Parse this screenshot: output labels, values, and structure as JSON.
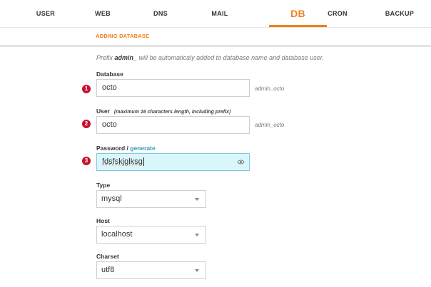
{
  "nav": {
    "items": [
      "USER",
      "WEB",
      "DNS",
      "MAIL",
      "DB",
      "CRON",
      "BACKUP"
    ],
    "active": "DB"
  },
  "subnav": {
    "label": "ADDING DATABASE"
  },
  "hint": {
    "before": "Prefix ",
    "prefix": "admin_",
    "after": " will be automaticaly added to database name and database user."
  },
  "form": {
    "database": {
      "label": "Database",
      "value": "octo",
      "suffix": "admin_octo",
      "step": "1"
    },
    "user": {
      "label": "User",
      "note": "(maximum 16 characters length, including prefix)",
      "value": "octo",
      "suffix": "admin_octo",
      "step": "2"
    },
    "password": {
      "label": "Password",
      "separator": " / ",
      "generate": "generate",
      "value": "fdsfskjglksg",
      "step": "3"
    },
    "type": {
      "label": "Type",
      "value": "mysql"
    },
    "host": {
      "label": "Host",
      "value": "localhost"
    },
    "charset": {
      "label": "Charset",
      "value": "utf8"
    }
  },
  "colors": {
    "accent": "#f07f1a",
    "link": "#2b9bb8",
    "badge": "#c8102e",
    "password_bg": "#d9f6fb"
  }
}
